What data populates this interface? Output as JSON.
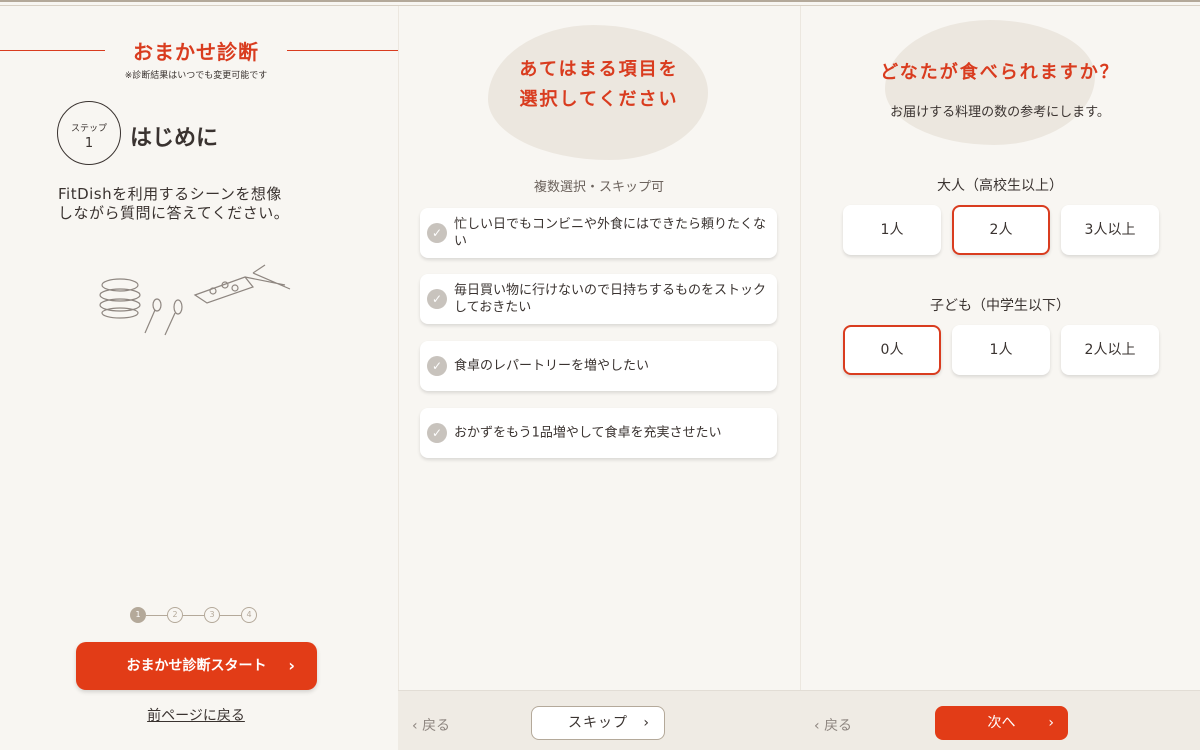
{
  "panel1": {
    "title": "おまかせ診断",
    "subtitle": "※診断結果はいつでも変更可能です",
    "step_label": "ステップ",
    "step_number": "1",
    "step_title": "はじめに",
    "intro_line1": "FitDishを利用するシーンを想像",
    "intro_line2": "しながら質問に答えてください。",
    "progress": [
      "1",
      "2",
      "3",
      "4"
    ],
    "start_button": "おまかせ診断スタート",
    "back_link": "前ページに戻る"
  },
  "panel2": {
    "title_line1": "あてはまる項目を",
    "title_line2": "選択してください",
    "hint": "複数選択・スキップ可",
    "options": [
      "忙しい日でもコンビニや外食にはできたら頼りたくない",
      "毎日買い物に行けないので日持ちするものをストックしておきたい",
      "食卓のレパートリーを増やしたい",
      "おかずをもう1品増やして食卓を充実させたい"
    ],
    "back": "戻る",
    "skip": "スキップ"
  },
  "panel3": {
    "title": "どなたが食べられますか？",
    "subtitle": "お届けする料理の数の参考にします。",
    "adults_label": "大人（高校生以上）",
    "adults_options": [
      "1人",
      "2人",
      "3人以上"
    ],
    "adults_selected": "2人",
    "children_label": "子ども（中学生以下）",
    "children_options": [
      "0人",
      "1人",
      "2人以上"
    ],
    "children_selected": "0人",
    "back": "戻る",
    "next": "次へ"
  },
  "colors": {
    "accent": "#e23c17",
    "background": "#f8f6f2",
    "blob": "#ece7df"
  },
  "icons": {
    "check": "check-circle-icon",
    "chevron": "chevron-right-icon",
    "back_chevron": "chevron-left-icon"
  }
}
